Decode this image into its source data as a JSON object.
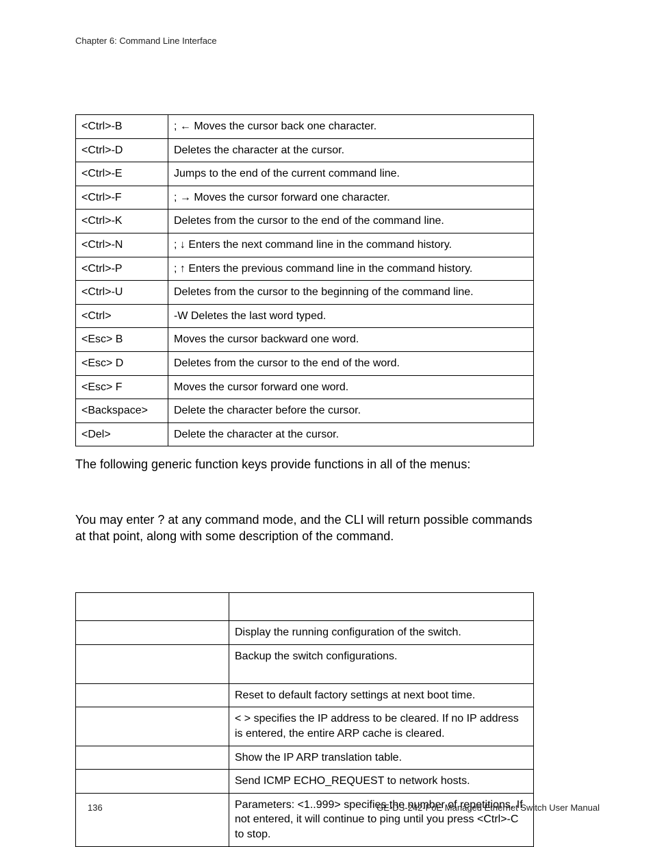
{
  "header": {
    "chapter": "Chapter 6: Command Line Interface"
  },
  "keys_table": {
    "rows": [
      {
        "key": "<Ctrl>-B",
        "desc": ";  ←   Moves the cursor back one character."
      },
      {
        "key": "<Ctrl>-D",
        "desc": "Deletes the character at the cursor."
      },
      {
        "key": "<Ctrl>-E",
        "desc": "Jumps to the end of the current command line."
      },
      {
        "key": "<Ctrl>-F",
        "desc": "; → Moves the cursor forward one character."
      },
      {
        "key": "<Ctrl>-K",
        "desc": "Deletes from the cursor to the end of the command line."
      },
      {
        "key": "<Ctrl>-N",
        "desc": "; ↓ Enters the next command line in the command history."
      },
      {
        "key": "<Ctrl>-P",
        "desc": "; ↑ Enters the previous command line in the command history."
      },
      {
        "key": "<Ctrl>-U",
        "desc": "Deletes from the cursor to the beginning of the command line."
      },
      {
        "key": "<Ctrl>",
        "desc": "-W Deletes the last word typed."
      },
      {
        "key": "<Esc> B",
        "desc": "Moves the cursor backward one word."
      },
      {
        "key": "<Esc> D",
        "desc": "Deletes from the cursor to the end of the word."
      },
      {
        "key": "<Esc> F",
        "desc": "Moves the cursor forward one word."
      },
      {
        "key": "<Backspace>",
        "desc": "Delete the character before the cursor."
      },
      {
        "key": "<Del>",
        "desc": "Delete the character at the cursor."
      }
    ]
  },
  "para1": "The following generic function keys provide functions in all of the menus:",
  "para2": "You may enter ? at any command mode, and the CLI will return possible commands at that point, along with some description of the command.",
  "cmds_table": {
    "rows": [
      {
        "cmd": "",
        "desc": ""
      },
      {
        "cmd": "",
        "desc": "Display the running configuration of the switch."
      },
      {
        "cmd": "",
        "desc": "Backup the switch configurations."
      },
      {
        "cmd": "",
        "desc": "Reset to default factory settings at next boot time."
      },
      {
        "cmd": "",
        "desc": "<          > specifies the IP address to be cleared. If no IP address is entered, the entire ARP cache is cleared."
      },
      {
        "cmd": "",
        "desc": "Show the IP ARP translation table."
      },
      {
        "cmd": "",
        "desc": "Send ICMP ECHO_REQUEST to network hosts."
      },
      {
        "cmd": "",
        "desc": "Parameters:  <1..999> specifies the number of repetitions. If not entered, it will continue to ping until you press <Ctrl>-C to stop."
      }
    ]
  },
  "footer": {
    "page": "136",
    "title": "GE-DS-242-PoE Managed Ethernet Switch User Manual"
  }
}
